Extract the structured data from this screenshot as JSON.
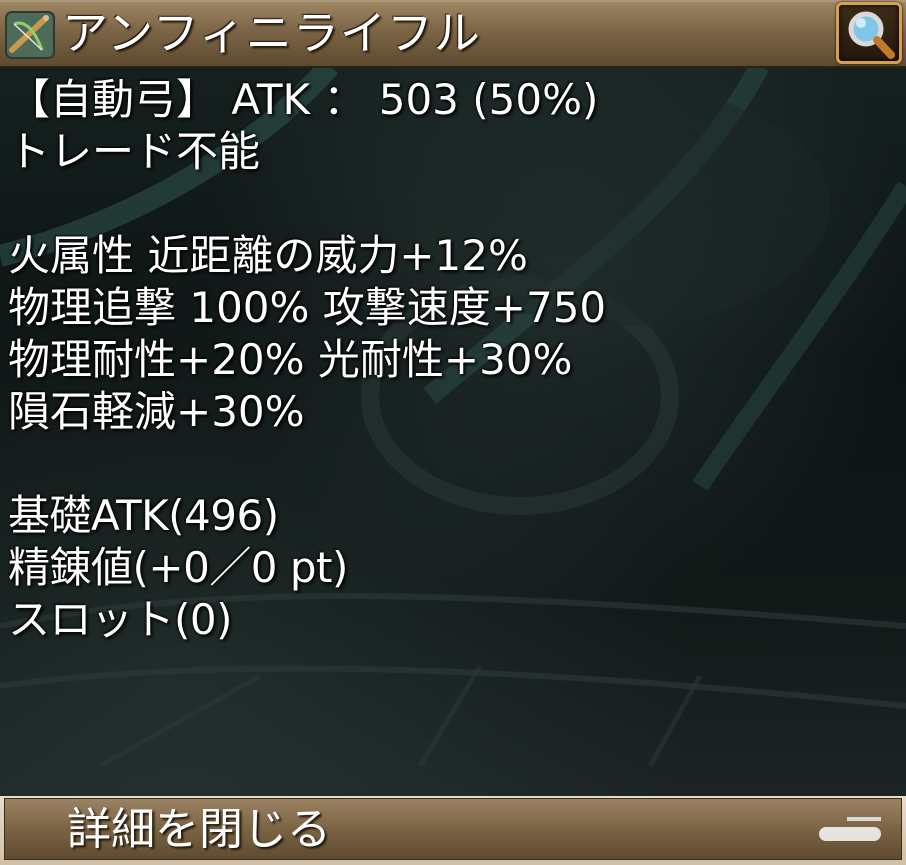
{
  "header": {
    "item_name": "アンフィニライフル",
    "item_icon": "crossbow-icon",
    "search_icon": "magnifier-icon"
  },
  "details": {
    "line_weapon": "【自動弓】 ATK ： 503 (50%)",
    "line_trade": "トレード不能",
    "effects": [
      "火属性 近距離の威力+12%",
      "物理追撃 100% 攻撃速度+750",
      "物理耐性+20% 光耐性+30%",
      "隕石軽減+30%"
    ],
    "stats": [
      "基礎ATK(496)",
      "精錬値(+0／0 pt)",
      "スロット(0)"
    ]
  },
  "footer": {
    "close_label": "詳細を閉じる"
  },
  "colors": {
    "title_bar": "#7d6646",
    "search_border": "#d6a04c",
    "text": "#ffffff",
    "background": "#0d1414"
  }
}
